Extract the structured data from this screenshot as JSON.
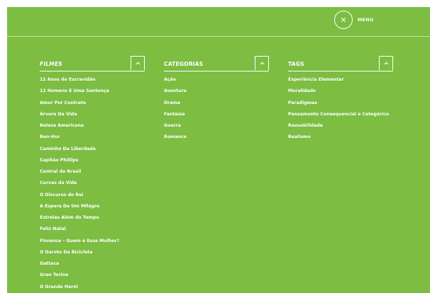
{
  "header": {
    "menu_close_icon": "close-icon",
    "menu_label": "MENU"
  },
  "columns": [
    {
      "title": "FILMES",
      "toggle_icon": "chevron-up-icon",
      "items": [
        "12 Anos de Escravidão",
        "12 Homens E Uma Sentença",
        "Amor Por Contrato",
        "Árvore Da Vida",
        "Beleza Americana",
        "Ben-Hur",
        "Caminho Da Liberdade",
        "Capitão Phillips",
        "Central do Brasil",
        "Curvas da Vida",
        "O Discurso do Rei",
        "A Espera De Um Milagre",
        "Estrelas Além do Tempo",
        "Feliz Natal",
        "Florence – Quem é Essa Mulher?",
        "O Garoto Da Bicicleta",
        "Gattaca",
        "Gran Torino",
        "O Grande Herói"
      ]
    },
    {
      "title": "CATEGORIAS",
      "toggle_icon": "chevron-up-icon",
      "items": [
        "Ação",
        "Aventura",
        "Drama",
        "Fantasia",
        "Guerra",
        "Romance"
      ]
    },
    {
      "title": "TAGS",
      "toggle_icon": "chevron-up-icon",
      "items": [
        "Experiência Elementar",
        "Moralidade",
        "Paradigmas",
        "Pensamento Consequencial e Categórico",
        "Razoabilidade",
        "Realismo"
      ]
    }
  ],
  "colors": {
    "panel_background": "#7cbd42",
    "text": "#ffffff"
  }
}
